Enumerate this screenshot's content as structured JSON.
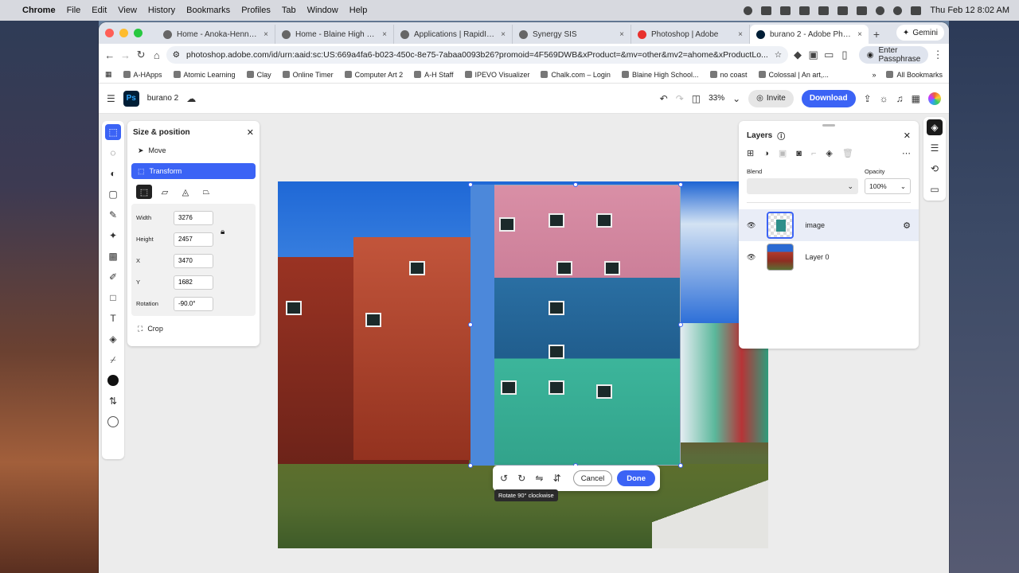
{
  "menubar": {
    "app": "Chrome",
    "items": [
      "File",
      "Edit",
      "View",
      "History",
      "Bookmarks",
      "Profiles",
      "Tab",
      "Window",
      "Help"
    ],
    "clock": "Thu Feb 12  8:02 AM"
  },
  "browser": {
    "tabs": [
      {
        "label": "Home - Anoka-Hennepin Sc",
        "close": "×"
      },
      {
        "label": "Home - Blaine High School",
        "close": "×"
      },
      {
        "label": "Applications | RapidIdentity",
        "close": "×"
      },
      {
        "label": "Synergy SIS",
        "close": "×"
      },
      {
        "label": "Photoshop | Adobe",
        "close": "×"
      },
      {
        "label": "burano 2 - Adobe Photosho",
        "close": "×"
      }
    ],
    "new_tab": "+",
    "gemini": "Gemini",
    "url": "photoshop.adobe.com/id/urn:aaid:sc:US:669a4fa6-b023-450c-8e75-7abaa0093b26?promoid=4F569DWB&xProduct=&mv=other&mv2=ahome&xProductLo...",
    "passphrase": "Enter Passphrase",
    "bookmarks": [
      "A-HApps",
      "Atomic Learning",
      "Clay",
      "Online Timer",
      "Computer Art 2",
      "A-H Staff",
      "IPEVO Visualizer",
      "Chalk.com – Login",
      "Blaine High School...",
      "no coast",
      "Colossal | An art,..."
    ],
    "all_bookmarks": "All Bookmarks"
  },
  "ps": {
    "logo": "Ps",
    "doc_title": "burano 2",
    "zoom": "33%",
    "invite": "Invite",
    "download": "Download"
  },
  "size_panel": {
    "title": "Size & position",
    "move": "Move",
    "transform": "Transform",
    "crop": "Crop",
    "fields": {
      "width_label": "Width",
      "width": "3276",
      "height_label": "Height",
      "height": "2457",
      "x_label": "X",
      "x": "3470",
      "y_label": "Y",
      "y": "1682",
      "rotation_label": "Rotation",
      "rotation": "-90.0°"
    }
  },
  "context_bar": {
    "cancel": "Cancel",
    "done": "Done",
    "tooltip": "Rotate 90° clockwise"
  },
  "layers_panel": {
    "title": "Layers",
    "blend_label": "Blend",
    "blend_value": "",
    "opacity_label": "Opacity",
    "opacity_value": "100%",
    "layers": [
      {
        "name": "image",
        "selected": true
      },
      {
        "name": "Layer 0",
        "selected": false
      }
    ]
  },
  "colors": {
    "accent": "#3b63f5",
    "ps_logo_bg": "#001e36",
    "ps_logo_fg": "#31a8ff"
  }
}
